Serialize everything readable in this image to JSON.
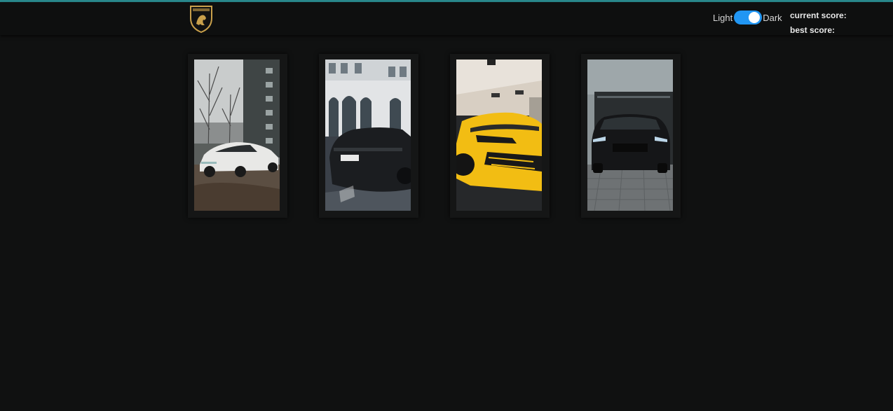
{
  "header": {
    "logo_label": "Lamborghini logo",
    "theme": {
      "light_label": "Light",
      "dark_label": "Dark",
      "enabled": true
    },
    "scores": {
      "current_label": "current score:",
      "best_label": "best score:"
    }
  },
  "cards": [
    {
      "name": "white-suv-card",
      "icon": "white-lamborghini-urus-photo"
    },
    {
      "name": "black-suv-rear-card",
      "icon": "black-lamborghini-urus-rear-photo"
    },
    {
      "name": "yellow-suv-front-card",
      "icon": "yellow-lamborghini-urus-front-photo"
    },
    {
      "name": "black-suv-front-card",
      "icon": "black-lamborghini-urus-front-photo"
    }
  ]
}
